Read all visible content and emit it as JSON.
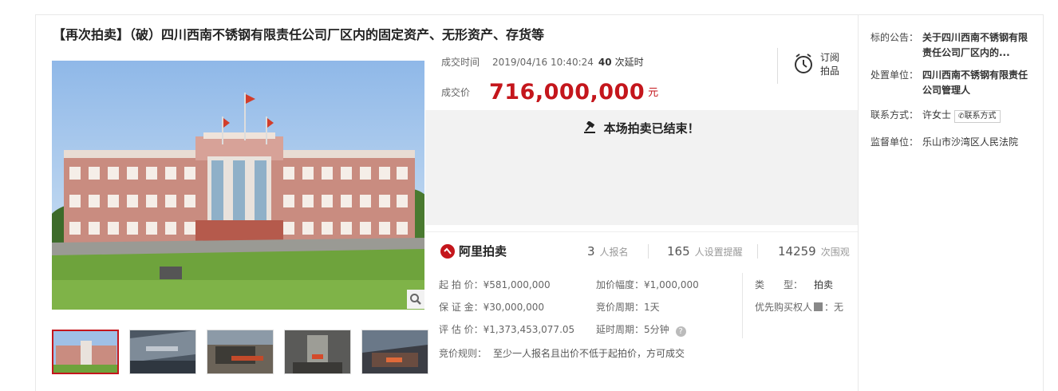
{
  "title": "【再次拍卖】（破）四川西南不锈钢有限责任公司厂区内的固定资产、无形资产、存货等",
  "deal": {
    "time_label": "成交时间",
    "time_value": "2019/04/16 10:40:24",
    "delay_count": "40",
    "delay_label": "次延时",
    "price_label": "成交价",
    "price_value": "716,000,000",
    "price_unit": "元"
  },
  "subscribe": {
    "line1": "订阅",
    "line2": "拍品",
    "icon": "alarm-clock-icon"
  },
  "ended_message": "本场拍卖已结束！",
  "platform": {
    "name": "阿里拍卖"
  },
  "stats": {
    "signups": "3",
    "signups_label": "人报名",
    "reminders": "165",
    "reminders_label": "人设置提醒",
    "views": "14259",
    "views_label": "次围观"
  },
  "details": {
    "start_price_label": "起 拍 价：",
    "start_price": "¥581,000,000",
    "deposit_label": "保 证 金：",
    "deposit": "¥30,000,000",
    "appraisal_label": "评 估 价：",
    "appraisal": "¥1,373,453,077.05",
    "increment_label": "加价幅度：",
    "increment": "¥1,000,000",
    "cycle_label": "竞价周期：",
    "cycle": "1天",
    "delay_label": "延时周期：",
    "delay": "5分钟",
    "type_label": "类　　型：",
    "type": "拍卖",
    "priority_label": "优先购买权人",
    "priority_value": "：无",
    "rule_label": "竞价规则：",
    "rule": "至少一人报名且出价不低于起拍价，方可成交"
  },
  "sidebar": {
    "notice_label": "标的公告：",
    "notice_value": "关于四川西南不锈钢有限责任公司厂区内的...",
    "handler_label": "处置单位：",
    "handler_value": "四川西南不锈钢有限责任公司管理人",
    "contact_label": "联系方式：",
    "contact_name": "许女士",
    "contact_button": "联系方式",
    "court_label": "监督单位：",
    "court_value": "乐山市沙湾区人民法院"
  },
  "colors": {
    "accent": "#c4161c",
    "muted": "#999999",
    "panel": "#f2f2f2"
  }
}
